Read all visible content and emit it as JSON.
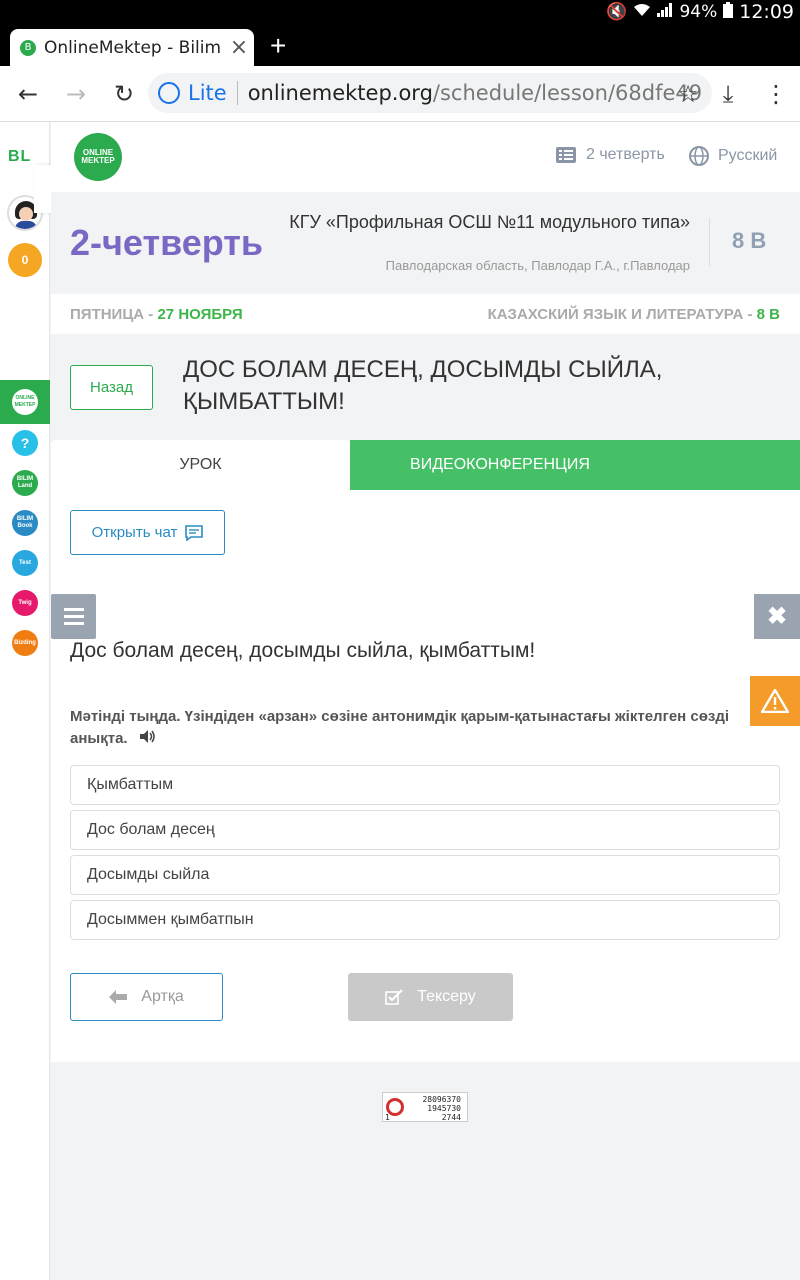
{
  "status_bar": {
    "battery": "94%",
    "time": "12:09"
  },
  "browser": {
    "tab_title": "OnlineMektep - Bilim",
    "tab_close": "×",
    "new_tab": "+",
    "lite_label": "Lite",
    "url_domain": "onlinemektep.org",
    "url_path": "/schedule/lesson/68dfe49"
  },
  "sidebar": {
    "logo": "BL",
    "coins": "0",
    "apps": [
      {
        "label": "ONLINE MEKTEP",
        "color": "#2bab4e"
      },
      {
        "label": "?",
        "color": "#29c0e8"
      },
      {
        "label": "BILIM Land",
        "color": "#2bab4e"
      },
      {
        "label": "BILIM Book",
        "color": "#2a8bc4"
      },
      {
        "label": "Test",
        "color": "#29a8e0"
      },
      {
        "label": "Twig",
        "color": "#e6196b"
      },
      {
        "label": "Bizding",
        "color": "#f07d12"
      }
    ]
  },
  "topbar": {
    "logo": "ONLINE MEKTEP",
    "quarter_menu": "2 четверть",
    "language": "Русский"
  },
  "header": {
    "quarter_title": "2-четверть",
    "school_name": "КГУ «Профильная ОСШ №11 модульного типа»",
    "school_region": "Павлодарская область, Павлодар Г.А., г.Павлодар",
    "class": "8 В"
  },
  "date_bar": {
    "day": "ПЯТНИЦА - ",
    "date": "27 НОЯБРЯ",
    "subject": "КАЗАХСКИЙ ЯЗЫК И ЛИТЕРАТУРА - ",
    "subject_class": "8 В"
  },
  "lesson": {
    "back_label": "Назад",
    "title": "ДОС БОЛАМ ДЕСЕҢ, ДОСЫМДЫ СЫЙЛА, ҚЫМБАТТЫМ!"
  },
  "tabs": {
    "lesson": "УРОК",
    "video": "ВИДЕОКОНФЕРЕНЦИЯ"
  },
  "content": {
    "chat_label": "Открыть чат",
    "task_title": "Дос болам десең, досымды сыйла, қымбаттым!",
    "question": "Мәтінді тыңда. Үзіндіден «арзан» сөзіне антонимдік қарым-қатынастағы жіктелген сөзді анықта.",
    "options": [
      "Қымбаттым",
      "Дос болам десең",
      "Досымды сыйла",
      "Досыммен қымбатпын"
    ],
    "prev_label": "Артқа",
    "check_label": "Тексеру"
  },
  "counter": {
    "line1": "28096370",
    "line2": "1945730",
    "line3": "2744",
    "line4": "1"
  }
}
